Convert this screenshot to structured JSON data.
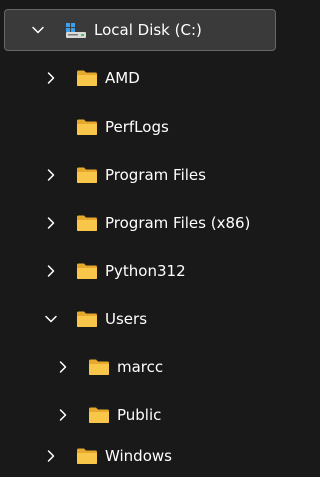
{
  "tree": {
    "root": {
      "label": "Local Disk (C:)",
      "icon": "drive-icon",
      "expanded": true,
      "selected": true
    },
    "items": [
      {
        "label": "AMD",
        "icon": "folder-icon",
        "expandable": true,
        "expanded": false
      },
      {
        "label": "PerfLogs",
        "icon": "folder-icon",
        "expandable": false,
        "expanded": false
      },
      {
        "label": "Program Files",
        "icon": "folder-icon",
        "expandable": true,
        "expanded": false
      },
      {
        "label": "Program Files (x86)",
        "icon": "folder-icon",
        "expandable": true,
        "expanded": false
      },
      {
        "label": "Python312",
        "icon": "folder-icon",
        "expandable": true,
        "expanded": false
      },
      {
        "label": "Users",
        "icon": "folder-icon",
        "expandable": true,
        "expanded": true,
        "children": [
          {
            "label": "marcc",
            "icon": "folder-icon",
            "expandable": true,
            "expanded": false
          },
          {
            "label": "Public",
            "icon": "folder-icon",
            "expandable": true,
            "expanded": false
          }
        ]
      },
      {
        "label": "Windows",
        "icon": "folder-icon",
        "expandable": true,
        "expanded": false
      }
    ]
  },
  "colors": {
    "background": "#191919",
    "selected_background": "#3a3a3a",
    "selected_border": "#676767",
    "folder_fill": "#f8c74a",
    "text": "#ffffff"
  }
}
